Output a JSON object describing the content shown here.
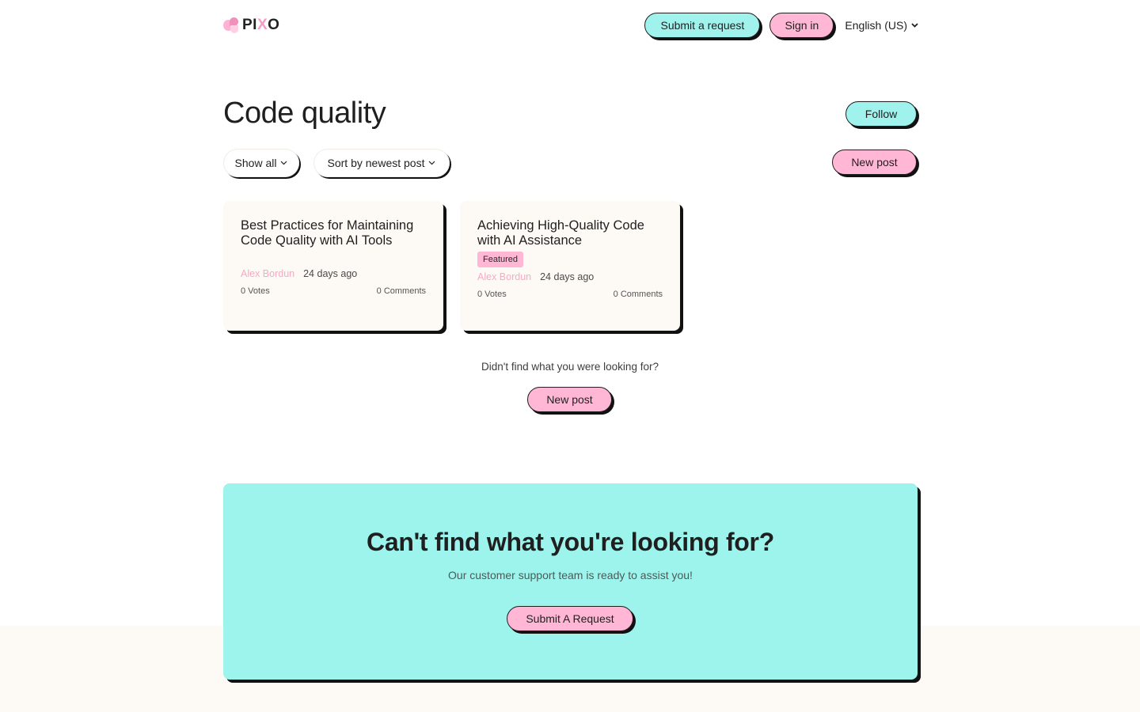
{
  "header": {
    "logo_text_a": "PI",
    "logo_text_x": "X",
    "logo_text_b": "O",
    "submit_request": "Submit a request",
    "sign_in": "Sign in",
    "language": "English (US)"
  },
  "page": {
    "title": "Code quality",
    "follow": "Follow",
    "filter_show": "Show all",
    "filter_sort": "Sort by newest post",
    "new_post": "New post"
  },
  "posts": [
    {
      "title": "Best Practices for Maintaining Code Quality with AI Tools",
      "author": "Alex Bordun",
      "date": "24 days ago",
      "votes": "0  Votes",
      "comments": "0  Comments"
    },
    {
      "title": "Achieving High-Quality Code with AI Assistance",
      "badge": "Featured",
      "author": "Alex Bordun",
      "date": "24 days ago",
      "votes": "0  Votes",
      "comments": "0  Comments"
    }
  ],
  "empty_prompt": {
    "text": "Didn't find what you were looking for?",
    "button": "New post"
  },
  "cta": {
    "title": "Can't find what you're looking for?",
    "subtitle": "Our customer support team is ready to assist you!",
    "button": "Submit A Request"
  },
  "colors": {
    "teal": "#9ff3ec",
    "pink": "#ffb7d5",
    "card_bg": "#fdf9f4",
    "author": "#f8a9c8"
  }
}
